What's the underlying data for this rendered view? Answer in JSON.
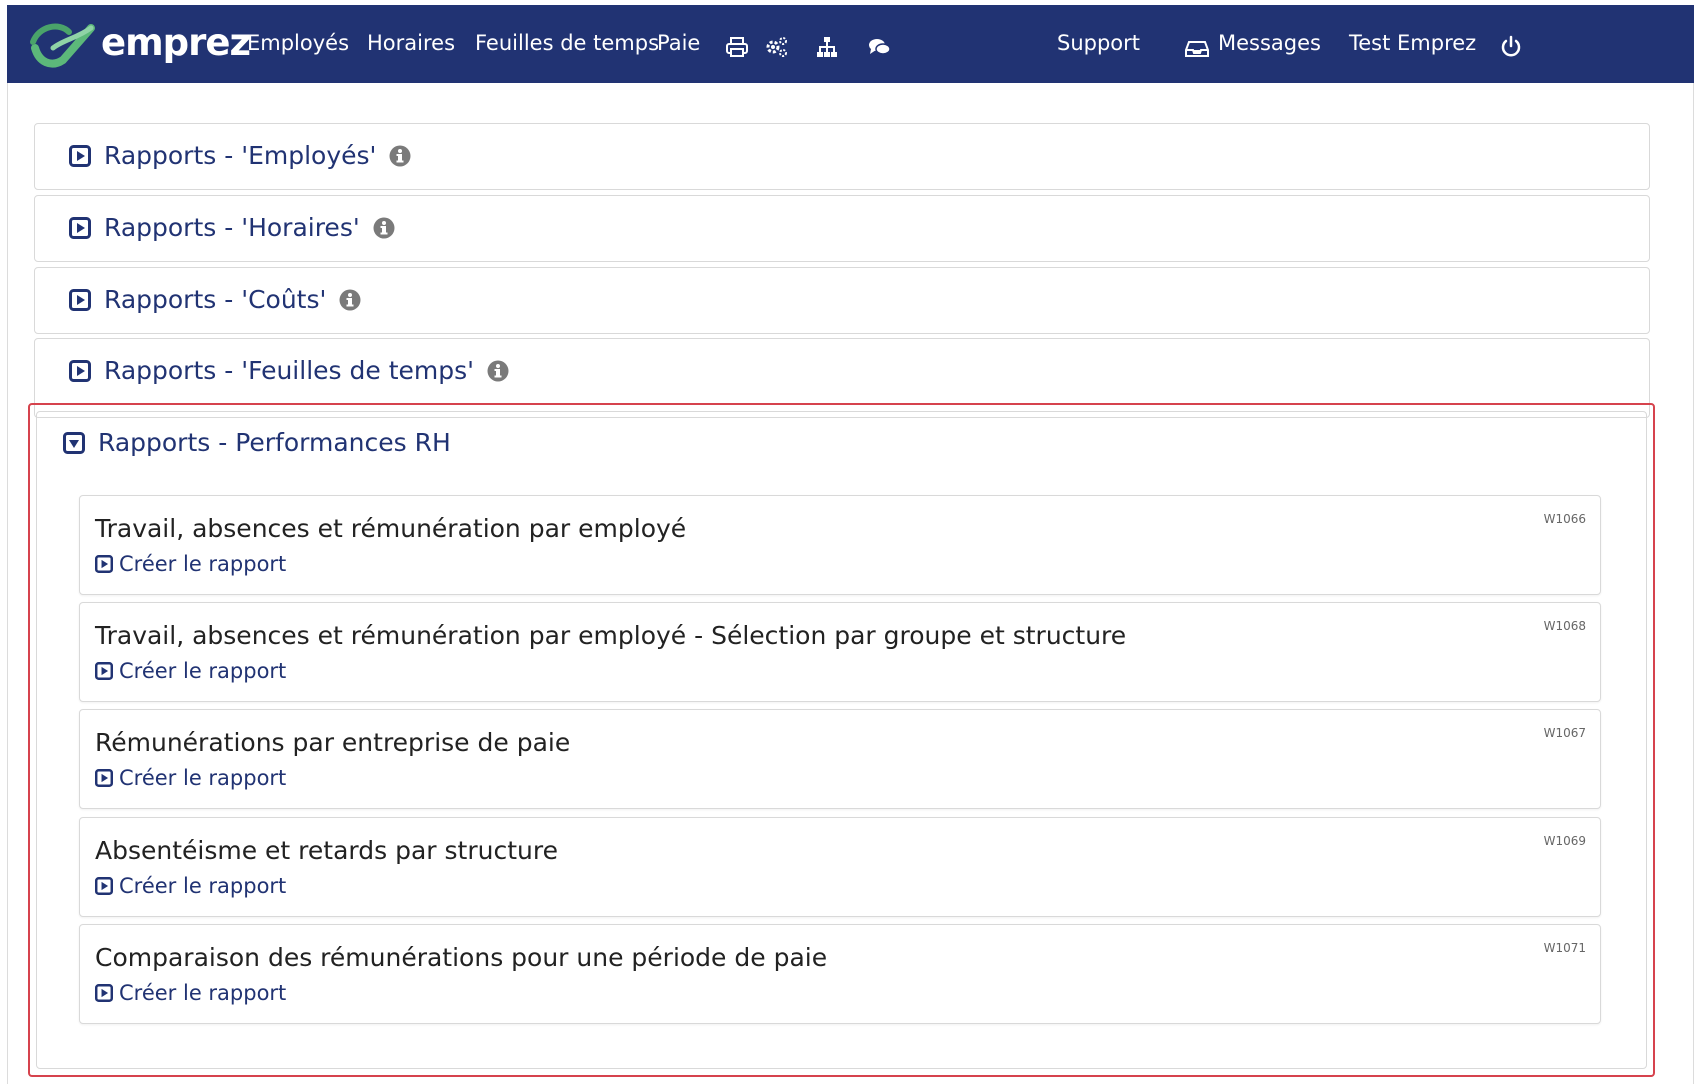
{
  "navbar": {
    "brand": "emprez",
    "links": {
      "employees": "Employés",
      "schedules": "Horaires",
      "timesheets": "Feuilles de temps",
      "payroll": "Paie",
      "support": "Support",
      "messages": "Messages",
      "user": "Test Emprez"
    },
    "icons": [
      "print-icon",
      "settings-icon",
      "org-chart-icon",
      "chat-icon",
      "inbox-icon",
      "power-icon"
    ]
  },
  "panels": [
    {
      "title": "Rapports - 'Employés'",
      "has_info": true,
      "expanded": false
    },
    {
      "title": "Rapports - 'Horaires'",
      "has_info": true,
      "expanded": false
    },
    {
      "title": "Rapports - 'Coûts'",
      "has_info": true,
      "expanded": false
    },
    {
      "title": "Rapports - 'Feuilles de temps'",
      "has_info": true,
      "expanded": false
    },
    {
      "title": "Rapports - Performances RH",
      "has_info": false,
      "expanded": true
    }
  ],
  "reports": [
    {
      "title": "Travail, absences et rémunération par employé",
      "link": "Créer le rapport",
      "code": "W1066"
    },
    {
      "title": "Travail, absences et rémunération par employé - Sélection par groupe et structure",
      "link": "Créer le rapport",
      "code": "W1068"
    },
    {
      "title": "Rémunérations par entreprise de paie",
      "link": "Créer le rapport",
      "code": "W1067"
    },
    {
      "title": "Absentéisme et retards par structure",
      "link": "Créer le rapport",
      "code": "W1069"
    },
    {
      "title": "Comparaison des rémunérations pour une période de paie",
      "link": "Créer le rapport",
      "code": "W1071"
    }
  ],
  "colors": {
    "navbar_bg": "#213373",
    "link": "#213373",
    "highlight_border": "#d6434d",
    "logo_green": "#5cb87a"
  }
}
